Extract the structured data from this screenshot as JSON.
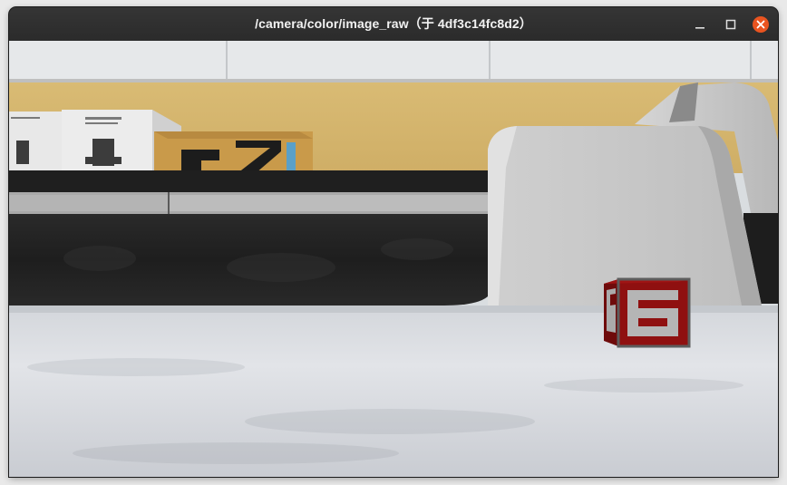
{
  "window": {
    "title": "/camera/color/image_raw（于 4df3c14fc8d2）"
  },
  "controls": {
    "minimize_icon": "minimize-icon",
    "maximize_icon": "maximize-icon",
    "close_icon": "close-icon",
    "close_color": "#e95420"
  },
  "camera_view": {
    "cube_digit": "6",
    "cube_color": "#8f1010",
    "floor_color": "#dfe2e6",
    "barrier_color": "#222222",
    "wall_color": "#d6b46c"
  }
}
